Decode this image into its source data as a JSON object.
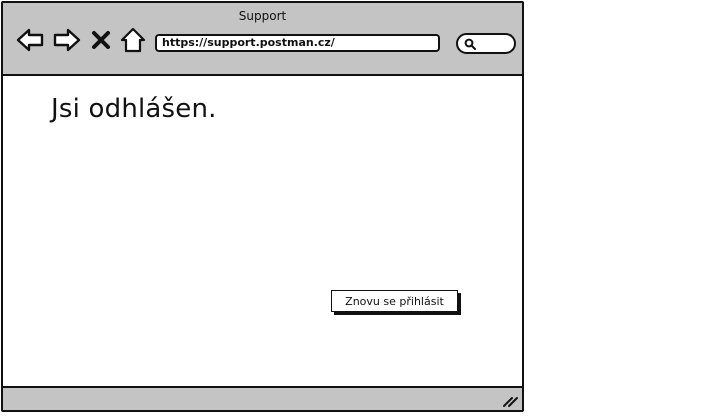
{
  "window": {
    "title": "Support"
  },
  "toolbar": {
    "back_icon": "arrow-left-icon",
    "forward_icon": "arrow-right-icon",
    "stop_icon": "close-icon",
    "home_icon": "home-icon",
    "url": "https://support.postman.cz/",
    "search_icon": "search-icon"
  },
  "main": {
    "heading": "Jsi odhlášen.",
    "relogin_label": "Znovu se přihlásit"
  },
  "statusbar": {
    "grip_icon": "resize-grip-icon"
  }
}
